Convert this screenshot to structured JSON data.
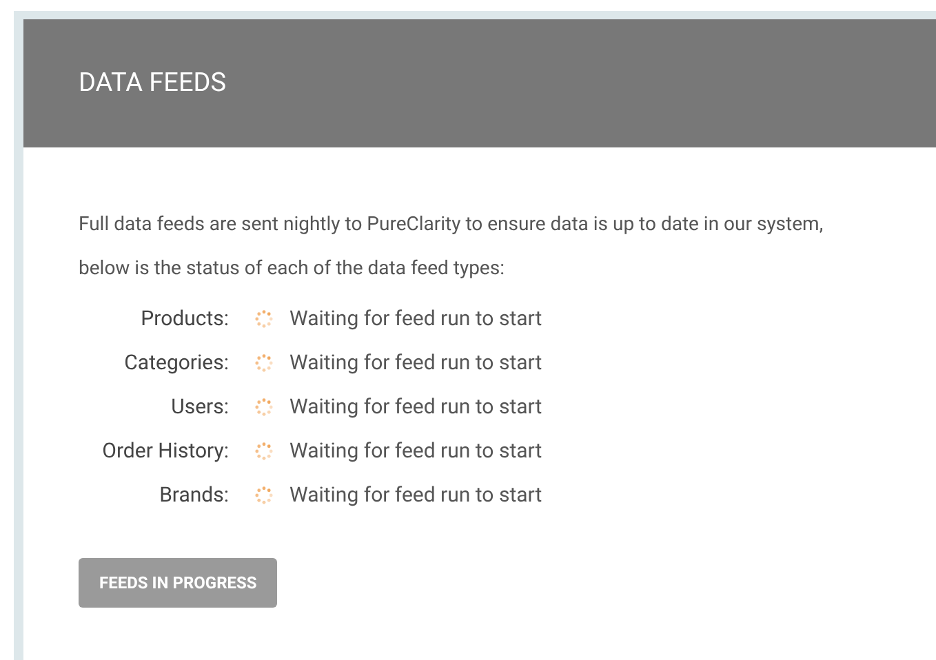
{
  "panel": {
    "title": "DATA FEEDS"
  },
  "intro": "Full data feeds are sent nightly to PureClarity to ensure data is up to date in our system, below is the status of each of the data feed types:",
  "feeds": [
    {
      "label": "Products:",
      "kind": "waiting",
      "message": "Waiting for feed run to start"
    },
    {
      "label": "Categories:",
      "kind": "waiting",
      "message": "Waiting for feed run to start"
    },
    {
      "label": "Users:",
      "kind": "waiting",
      "message": "Waiting for feed run to start"
    },
    {
      "label": "Order History:",
      "kind": "waiting",
      "message": "Waiting for feed run to start"
    },
    {
      "label": "Brands:",
      "kind": "waiting",
      "message": "Waiting for feed run to start"
    }
  ],
  "button": {
    "label": "FEEDS IN PROGRESS",
    "disabled": true
  }
}
